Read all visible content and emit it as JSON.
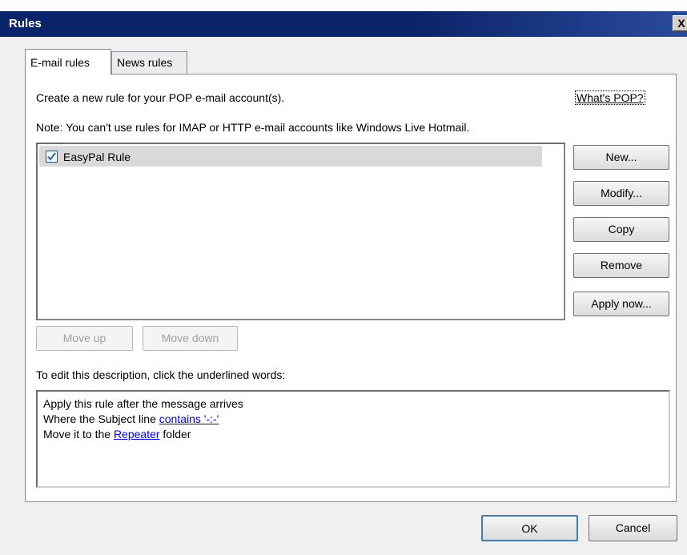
{
  "window": {
    "title": "Rules",
    "close_label": "X"
  },
  "tabs": [
    {
      "label": "E-mail rules",
      "selected": true
    },
    {
      "label": "News rules",
      "selected": false
    }
  ],
  "email_rules": {
    "intro": "Create a new rule for your POP e-mail account(s).",
    "whats_pop_link": "What's POP?",
    "note": "Note: You can't use rules for IMAP or HTTP e-mail accounts like Windows Live Hotmail.",
    "rules": [
      {
        "name": "EasyPal Rule",
        "checked": true,
        "selected": true
      }
    ],
    "side_buttons": {
      "new": "New...",
      "modify": "Modify...",
      "copy": "Copy",
      "remove": "Remove",
      "apply_now": "Apply now..."
    },
    "move_up": "Move up",
    "move_down": "Move down",
    "description_label": "To edit this description, click the underlined words:",
    "description": {
      "line1": "Apply this rule after the message arrives",
      "line2_prefix": "Where the Subject line ",
      "line2_link": "contains '-:-'",
      "line3_prefix": "Move it to the ",
      "line3_link": "Repeater",
      "line3_suffix": " folder"
    }
  },
  "footer": {
    "ok": "OK",
    "cancel": "Cancel"
  },
  "colors": {
    "titlebar": "#0a246a",
    "link": "#0000ee",
    "check": "#2a6fb3"
  }
}
